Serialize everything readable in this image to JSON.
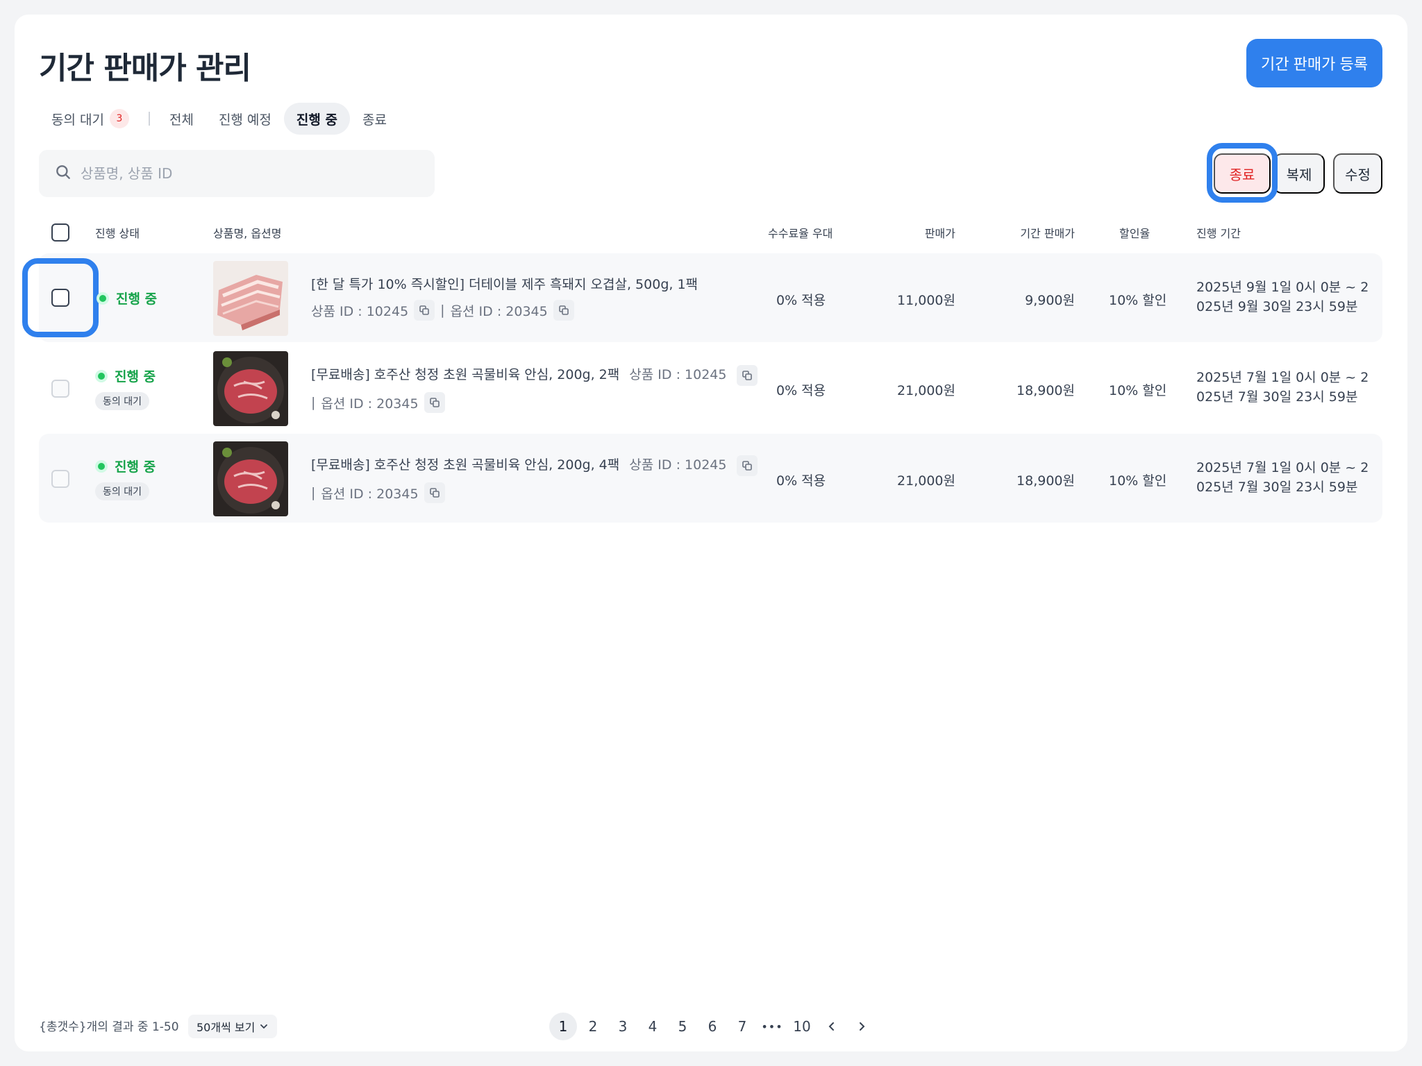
{
  "page": {
    "title": "기간 판매가 관리",
    "register_button": "기간 판매가 등록"
  },
  "tabs": [
    {
      "label": "동의 대기",
      "badge": "3"
    },
    {
      "label": "전체"
    },
    {
      "label": "진행 예정"
    },
    {
      "label": "진행 중",
      "active": true
    },
    {
      "label": "종료"
    }
  ],
  "search": {
    "placeholder": "상품명, 상품 ID"
  },
  "actions": {
    "end": "종료",
    "duplicate": "복제",
    "edit": "수정"
  },
  "columns": {
    "status": "진행 상태",
    "product": "상품명, 옵션명",
    "fee": "수수료율 우대",
    "price": "판매가",
    "period_price": "기간 판매가",
    "discount": "할인율",
    "period": "진행 기간"
  },
  "rows": [
    {
      "status": "진행 중",
      "name": "[한 달 특가 10% 즉시할인] 더테이블 제주 흑돼지 오겹살, 500g, 1팩",
      "product_id": "상품 ID : 10245",
      "option_id": "옵션 ID : 20345",
      "fee": "0% 적용",
      "price": "11,000원",
      "period_price": "9,900원",
      "discount": "10% 할인",
      "period": "2025년 9월 1일 0시 0분 ~ 2025년 9월 30일 23시 59분"
    },
    {
      "status": "진행 중",
      "pending": "동의 대기",
      "name": "[무료배송] 호주산 청정 초원 곡물비육 안심, 200g, 2팩",
      "product_id": "상품 ID : 10245",
      "option_id": "옵션 ID : 20345",
      "fee": "0% 적용",
      "price": "21,000원",
      "period_price": "18,900원",
      "discount": "10% 할인",
      "period": "2025년 7월 1일 0시 0분 ~ 2025년 7월 30일 23시 59분"
    },
    {
      "status": "진행 중",
      "pending": "동의 대기",
      "name": "[무료배송] 호주산 청정 초원 곡물비육 안심, 200g, 4팩",
      "product_id": "상품 ID : 10245",
      "option_id": "옵션 ID : 20345",
      "fee": "0% 적용",
      "price": "21,000원",
      "period_price": "18,900원",
      "discount": "10% 할인",
      "period": "2025년 7월 1일 0시 0분 ~ 2025년 7월 30일 23시 59분"
    }
  ],
  "footer": {
    "summary": "{총갯수}개의 결과 중 1-50",
    "per_page": "50개씩 보기",
    "pages": [
      "1",
      "2",
      "3",
      "4",
      "5",
      "6",
      "7"
    ],
    "ellipsis": "•••",
    "last_page": "10",
    "current_page": "1"
  },
  "colors": {
    "accent": "#2f80ed",
    "status_green": "#16a34a",
    "danger": "#e02424"
  }
}
